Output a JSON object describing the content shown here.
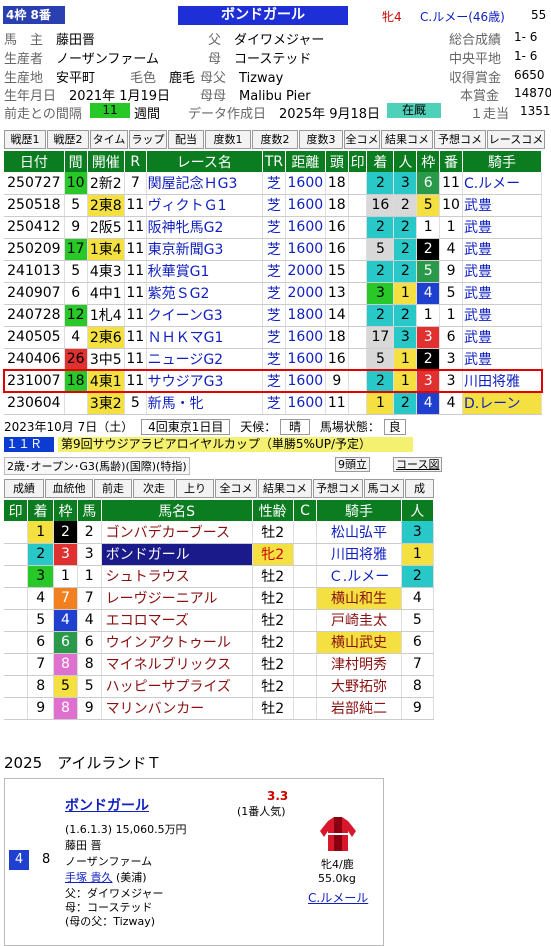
{
  "header": {
    "frame_badge": "4枠 8番",
    "horse_name": "ボンドガール",
    "sex_age": "牝4",
    "jockey": "C.ルメー(46歳)",
    "weight_cut": "55"
  },
  "info_left": [
    {
      "label": "馬　主",
      "value": "藤田晋"
    },
    {
      "label": "生産者",
      "value": "ノーザンファーム"
    },
    {
      "label": "生産地",
      "value": "安平町"
    },
    {
      "label": "生年月日",
      "value": "2021年 1月19日"
    },
    {
      "label": "前走との間隔",
      "value": "11",
      "suffix": "週間"
    }
  ],
  "info_mid": [
    {
      "label": "父",
      "value": "ダイワメジャー"
    },
    {
      "label": "母",
      "value": "コーステッド"
    },
    {
      "label": "母父",
      "value": "Tizway"
    },
    {
      "label": "母母",
      "value": "Malibu Pier"
    },
    {
      "label": "データ作成日",
      "value": "2025年 9月18日"
    }
  ],
  "coat": {
    "label": "毛色",
    "value": "鹿毛"
  },
  "stable": "在厩",
  "info_right": [
    {
      "label": "総合成績",
      "value": "1- 6"
    },
    {
      "label": "中央平地",
      "value": "1- 6"
    },
    {
      "label": "収得賞金",
      "value": "6650"
    },
    {
      "label": "本賞金",
      "value": "14870"
    },
    {
      "label": "１走当",
      "value": "1351"
    }
  ],
  "tabs": [
    "戦歴1",
    "戦歴2",
    "タイム",
    "ラップ",
    "配当",
    "度数1",
    "度数2",
    "度数3",
    "全コメ",
    "結果コメ",
    "予想コメ",
    "レースコメ"
  ],
  "race_table": {
    "headers": [
      "日付",
      "間",
      "開催",
      "R",
      "レース名",
      "TR",
      "距離",
      "頭",
      "印",
      "着",
      "人",
      "枠",
      "番",
      "騎手"
    ],
    "rows": [
      {
        "date": "250727",
        "gap": "10",
        "venue": "2新2",
        "r": "7",
        "name": "関屋記念ＨG3",
        "tr": "芝",
        "dist": "1600",
        "heads": "18",
        "mark": "",
        "finish": "2",
        "pop": "3",
        "frame": "6",
        "num": "11",
        "jockey": "C.ルメー",
        "gapc": "#28c828",
        "venuec": "",
        "finc": "#28c8c8",
        "popc": "#28c8c8",
        "framec": "#2a9a4a",
        "framefc": "#fff"
      },
      {
        "date": "250518",
        "gap": "5",
        "venue": "2東8",
        "r": "11",
        "name": "ヴィクトＧ1",
        "tr": "芝",
        "dist": "1600",
        "heads": "18",
        "mark": "",
        "finish": "16",
        "pop": "2",
        "frame": "5",
        "num": "10",
        "jockey": "武豊",
        "gapc": "",
        "venuec": "#f4e040",
        "finc": "#d8d8d8",
        "popc": "#d8d8d8",
        "framec": "#f4e040",
        "framefc": "#000"
      },
      {
        "date": "250412",
        "gap": "9",
        "venue": "2阪5",
        "r": "11",
        "name": "阪神牝馬G2",
        "tr": "芝",
        "dist": "1600",
        "heads": "16",
        "mark": "",
        "finish": "2",
        "pop": "2",
        "frame": "1",
        "num": "1",
        "jockey": "武豊",
        "gapc": "",
        "venuec": "",
        "finc": "#28c8c8",
        "popc": "#28c8c8",
        "framec": "#fff",
        "framefc": "#000"
      },
      {
        "date": "250209",
        "gap": "17",
        "venue": "1東4",
        "r": "11",
        "name": "東京新聞G3",
        "tr": "芝",
        "dist": "1600",
        "heads": "16",
        "mark": "",
        "finish": "5",
        "pop": "2",
        "frame": "2",
        "num": "4",
        "jockey": "武豊",
        "gapc": "#28c828",
        "venuec": "#f4e040",
        "finc": "#d8d8d8",
        "popc": "#28c8c8",
        "framec": "#000",
        "framefc": "#fff"
      },
      {
        "date": "241013",
        "gap": "5",
        "venue": "4東3",
        "r": "11",
        "name": "秋華賞G1",
        "tr": "芝",
        "dist": "2000",
        "heads": "15",
        "mark": "",
        "finish": "2",
        "pop": "2",
        "frame": "5",
        "num": "9",
        "jockey": "武豊",
        "gapc": "",
        "venuec": "",
        "finc": "#28c8c8",
        "popc": "#28c8c8",
        "framec": "#2a9a4a",
        "framefc": "#fff"
      },
      {
        "date": "240907",
        "gap": "6",
        "venue": "4中1",
        "r": "11",
        "name": "紫苑ＳG2",
        "tr": "芝",
        "dist": "2000",
        "heads": "13",
        "mark": "",
        "finish": "3",
        "pop": "1",
        "frame": "4",
        "num": "5",
        "jockey": "武豊",
        "gapc": "",
        "venuec": "",
        "finc": "#28c828",
        "popc": "#f4e040",
        "framec": "#1f3fcf",
        "framefc": "#fff"
      },
      {
        "date": "240728",
        "gap": "12",
        "venue": "1札4",
        "r": "11",
        "name": "クイーンG3",
        "tr": "芝",
        "dist": "1800",
        "heads": "14",
        "mark": "",
        "finish": "2",
        "pop": "2",
        "frame": "1",
        "num": "1",
        "jockey": "武豊",
        "gapc": "#28c828",
        "venuec": "",
        "finc": "#28c8c8",
        "popc": "#28c8c8",
        "framec": "#fff",
        "framefc": "#000"
      },
      {
        "date": "240505",
        "gap": "4",
        "venue": "2東6",
        "r": "11",
        "name": "ＮＨＫマG1",
        "tr": "芝",
        "dist": "1600",
        "heads": "18",
        "mark": "",
        "finish": "17",
        "pop": "3",
        "frame": "3",
        "num": "6",
        "jockey": "武豊",
        "gapc": "",
        "venuec": "#f4e040",
        "finc": "#d8d8d8",
        "popc": "#28c8c8",
        "framec": "#e03030",
        "framefc": "#fff"
      },
      {
        "date": "240406",
        "gap": "26",
        "venue": "3中5",
        "r": "11",
        "name": "ニュージG2",
        "tr": "芝",
        "dist": "1600",
        "heads": "16",
        "mark": "",
        "finish": "5",
        "pop": "1",
        "frame": "2",
        "num": "3",
        "jockey": "武豊",
        "gapc": "#e03030",
        "venuec": "",
        "finc": "#d8d8d8",
        "popc": "#f4e040",
        "framec": "#000",
        "framefc": "#fff"
      },
      {
        "date": "231007",
        "gap": "18",
        "venue": "4東1",
        "r": "11",
        "name": "サウジアG3",
        "tr": "芝",
        "dist": "1600",
        "heads": "9",
        "mark": "",
        "finish": "2",
        "pop": "1",
        "frame": "3",
        "num": "3",
        "jockey": "川田将雅",
        "gapc": "#28c828",
        "venuec": "#f4e040",
        "finc": "#28c8c8",
        "popc": "#f4e040",
        "framec": "#e03030",
        "framefc": "#fff",
        "hl": true
      },
      {
        "date": "230604",
        "gap": "",
        "venue": "3東2",
        "r": "5",
        "name": "新馬・牝",
        "tr": "芝",
        "dist": "1600",
        "heads": "11",
        "mark": "",
        "finish": "1",
        "pop": "2",
        "frame": "4",
        "num": "4",
        "jockey": "D.レーン",
        "gapc": "",
        "venuec": "#f4e040",
        "finc": "#f4e040",
        "popc": "#28c8c8",
        "framec": "#1f3fcf",
        "framefc": "#fff",
        "jockeyc": "#f4e040"
      }
    ]
  },
  "race_detail": {
    "date": "2023年10月 7日（土）",
    "meet": "4回東京1日目",
    "weather_label": "天候：",
    "weather": "晴",
    "track_label": "馬場状態：",
    "track": "良",
    "race_no": "１１Ｒ",
    "race_name": "第9回サウジアラビアロイヤルカップ（単勝5%UP/予定）",
    "condition": "2歳･オープン･G3(馬齢)(国際)(特指)",
    "heads_btn": "9頭立",
    "course_btn": "コース図",
    "tabs": [
      "成績",
      "血統他",
      "前走",
      "次走",
      "上り",
      "全コメ",
      "結果コメ",
      "予想コメ",
      "馬コメ",
      "成"
    ]
  },
  "result_table": {
    "headers": [
      "印",
      "着",
      "枠",
      "馬",
      "馬名S",
      "性齢",
      "C",
      "騎手",
      "人"
    ],
    "rows": [
      {
        "mark": "",
        "fin": "1",
        "frame": "2",
        "num": "2",
        "name": "ゴンバデカーブース",
        "sa": "牡2",
        "jockey": "松山弘平",
        "pop": "3",
        "finc": "#f4e040",
        "framec": "#000",
        "framefc": "#fff",
        "popc": "#28c8c8"
      },
      {
        "mark": "",
        "fin": "2",
        "frame": "3",
        "num": "3",
        "name": "ボンドガール",
        "sa": "牝2",
        "jockey": "川田将雅",
        "pop": "1",
        "finc": "#28c8c8",
        "framec": "#e03030",
        "framefc": "#fff",
        "popc": "#f4e040",
        "self": true
      },
      {
        "mark": "",
        "fin": "3",
        "frame": "1",
        "num": "1",
        "name": "シュトラウス",
        "sa": "牡2",
        "jockey": "Ｃ.ルメー",
        "pop": "2",
        "finc": "#28c828",
        "framec": "#fff",
        "framefc": "#000",
        "popc": "#28c8c8"
      },
      {
        "mark": "",
        "fin": "4",
        "frame": "7",
        "num": "7",
        "name": "レーヴジーニアル",
        "sa": "牡2",
        "jockey": "横山和生",
        "pop": "4",
        "finc": "",
        "framec": "#f08020",
        "framefc": "#fff",
        "popc": "",
        "jbg": "#f4e040"
      },
      {
        "mark": "",
        "fin": "5",
        "frame": "4",
        "num": "4",
        "name": "エコロマーズ",
        "sa": "牡2",
        "jockey": "戸崎圭太",
        "pop": "5",
        "finc": "",
        "framec": "#1f3fcf",
        "framefc": "#fff",
        "popc": ""
      },
      {
        "mark": "",
        "fin": "6",
        "frame": "6",
        "num": "6",
        "name": "ウインアクトゥール",
        "sa": "牡2",
        "jockey": "横山武史",
        "pop": "6",
        "finc": "",
        "framec": "#2a9a4a",
        "framefc": "#fff",
        "popc": "",
        "jbg": "#f4e040"
      },
      {
        "mark": "",
        "fin": "7",
        "frame": "8",
        "num": "8",
        "name": "マイネルブリックス",
        "sa": "牡2",
        "jockey": "津村明秀",
        "pop": "7",
        "finc": "",
        "framec": "#e070d0",
        "framefc": "#fff",
        "popc": ""
      },
      {
        "mark": "",
        "fin": "8",
        "frame": "5",
        "num": "5",
        "name": "ハッピーサプライズ",
        "sa": "牡2",
        "jockey": "大野拓弥",
        "pop": "8",
        "finc": "",
        "framec": "#f4e040",
        "framefc": "#000",
        "popc": ""
      },
      {
        "mark": "",
        "fin": "9",
        "frame": "8",
        "num": "9",
        "name": "マリンバンカー",
        "sa": "牡2",
        "jockey": "岩部純二",
        "pop": "9",
        "finc": "",
        "framec": "#e070d0",
        "framefc": "#fff",
        "popc": ""
      }
    ]
  },
  "year_title": "2025　アイルランドＴ",
  "card": {
    "frame": "4",
    "num": "8",
    "name": "ボンドガール",
    "odds": "3.3",
    "popularity": "(1番人気)",
    "record": "(1.6.1.3)",
    "prize": "15,060.5万円",
    "owner": "藤田 晋",
    "breeder": "ノーザンファーム",
    "trainer": "手塚 貴久",
    "trainer_loc": "(美浦)",
    "sire": "父：ダイワメジャー",
    "dam": "母：コーステッド",
    "damsire": "(母の父：Tizway)",
    "sex_age": "牝4/鹿",
    "weight": "55.0kg",
    "jockey": "C.ルメール"
  },
  "colors": {
    "green": "#0b7d20",
    "blue_title": "#1f2fd8",
    "link": "#1020c0",
    "highlight": "#e00000"
  }
}
